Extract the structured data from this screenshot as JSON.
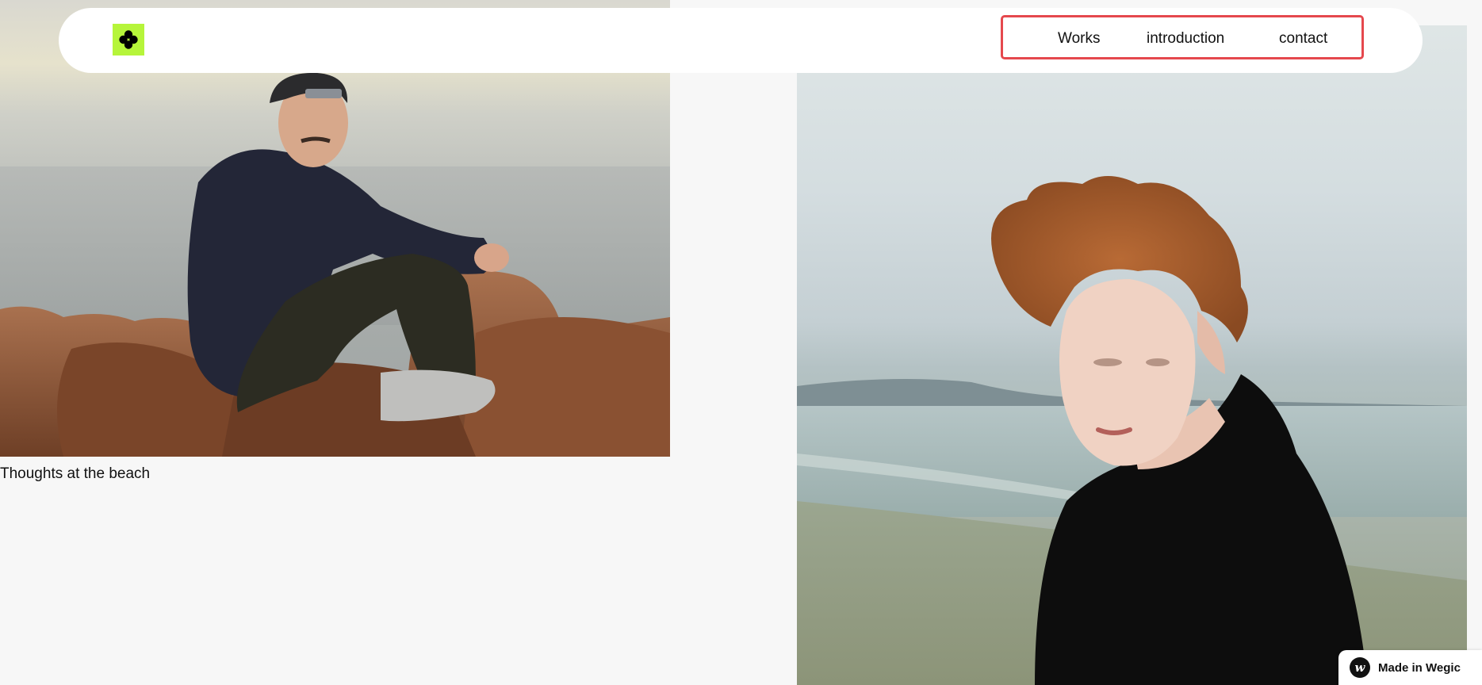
{
  "header": {
    "logo_icon": "clover-icon",
    "logo_color": "#b6f53a",
    "highlight_color": "#e5484d",
    "nav": {
      "works": "Works",
      "introduction": "introduction",
      "contact": "contact"
    }
  },
  "gallery": {
    "left_item": {
      "caption": "Thoughts at the beach"
    },
    "right_item": {}
  },
  "badge": {
    "icon": "wegic-logo-icon",
    "label": "Made in Wegic"
  }
}
